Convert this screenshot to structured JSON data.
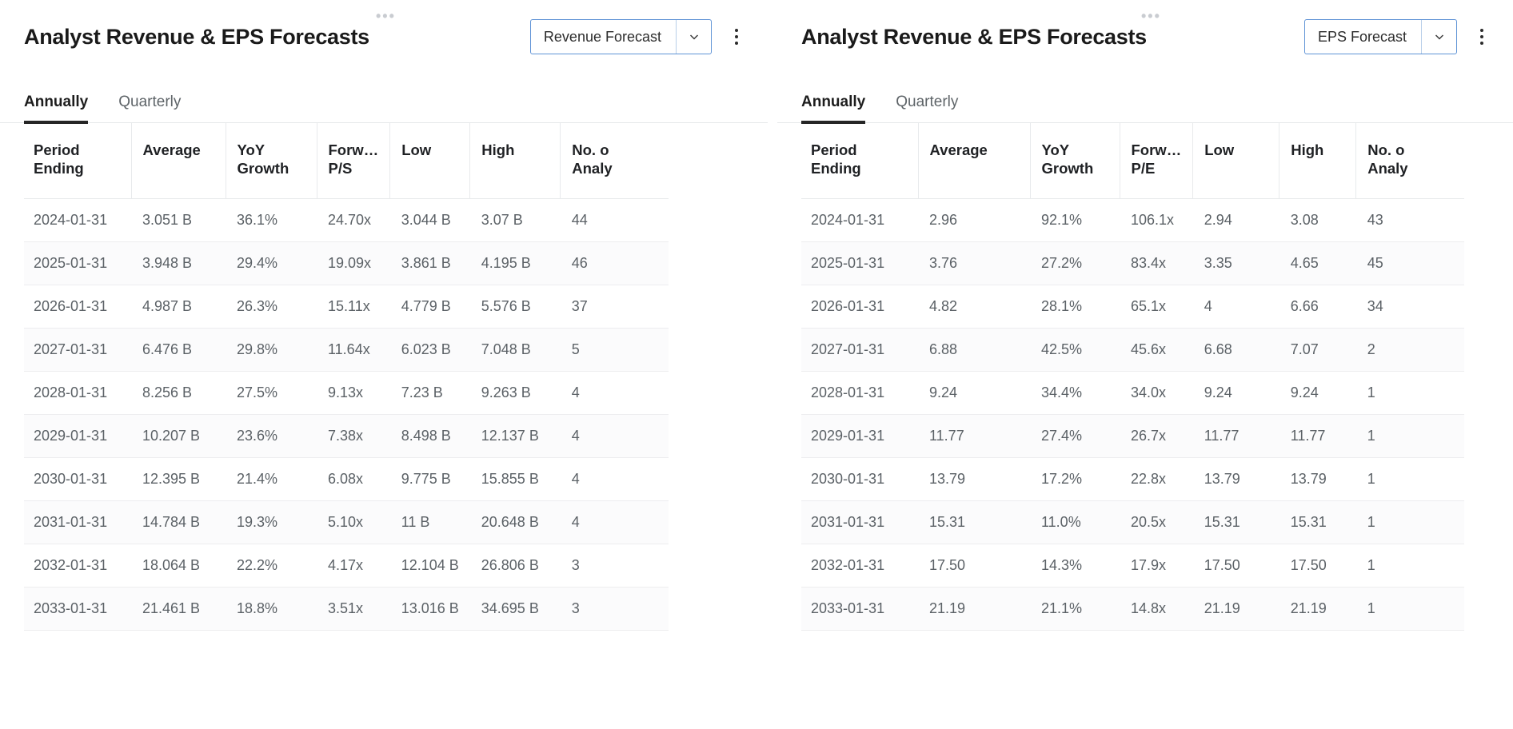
{
  "panels": [
    {
      "title": "Analyst Revenue & EPS Forecasts",
      "drag_handle": "•••",
      "selector": {
        "value": "Revenue Forecast",
        "arrow_icon": "chevron-down-icon"
      },
      "menu_icon": "kebab-menu-icon",
      "tabs": [
        {
          "label": "Annually",
          "active": true
        },
        {
          "label": "Quarterly",
          "active": false
        }
      ],
      "table": {
        "columns": [
          "Period Ending",
          "Average",
          "YoY Growth",
          "Forw… P/S",
          "Low",
          "High",
          "No. o Analy"
        ],
        "columns_line1": [
          "Period",
          "Average",
          "YoY",
          "Forw…",
          "Low",
          "High",
          "No. o"
        ],
        "columns_line2": [
          "Ending",
          "",
          "Growth",
          "P/S",
          "",
          "",
          "Analy"
        ],
        "rows": [
          [
            "2024-01-31",
            "3.051 B",
            "36.1%",
            "24.70x",
            "3.044 B",
            "3.07 B",
            "44"
          ],
          [
            "2025-01-31",
            "3.948 B",
            "29.4%",
            "19.09x",
            "3.861 B",
            "4.195 B",
            "46"
          ],
          [
            "2026-01-31",
            "4.987 B",
            "26.3%",
            "15.11x",
            "4.779 B",
            "5.576 B",
            "37"
          ],
          [
            "2027-01-31",
            "6.476 B",
            "29.8%",
            "11.64x",
            "6.023 B",
            "7.048 B",
            "5"
          ],
          [
            "2028-01-31",
            "8.256 B",
            "27.5%",
            "9.13x",
            "7.23 B",
            "9.263 B",
            "4"
          ],
          [
            "2029-01-31",
            "10.207 B",
            "23.6%",
            "7.38x",
            "8.498 B",
            "12.137 B",
            "4"
          ],
          [
            "2030-01-31",
            "12.395 B",
            "21.4%",
            "6.08x",
            "9.775 B",
            "15.855 B",
            "4"
          ],
          [
            "2031-01-31",
            "14.784 B",
            "19.3%",
            "5.10x",
            "11 B",
            "20.648 B",
            "4"
          ],
          [
            "2032-01-31",
            "18.064 B",
            "22.2%",
            "4.17x",
            "12.104 B",
            "26.806 B",
            "3"
          ],
          [
            "2033-01-31",
            "21.461 B",
            "18.8%",
            "3.51x",
            "13.016 B",
            "34.695 B",
            "3"
          ]
        ]
      }
    },
    {
      "title": "Analyst Revenue & EPS Forecasts",
      "drag_handle": "•••",
      "selector": {
        "value": "EPS Forecast",
        "arrow_icon": "chevron-down-icon"
      },
      "menu_icon": "kebab-menu-icon",
      "tabs": [
        {
          "label": "Annually",
          "active": true
        },
        {
          "label": "Quarterly",
          "active": false
        }
      ],
      "table": {
        "columns": [
          "Period Ending",
          "Average",
          "YoY Growth",
          "Forw… P/E",
          "Low",
          "High",
          "No. o Analy"
        ],
        "columns_line1": [
          "Period",
          "Average",
          "YoY",
          "Forw…",
          "Low",
          "High",
          "No. o"
        ],
        "columns_line2": [
          "Ending",
          "",
          "Growth",
          "P/E",
          "",
          "",
          "Analy"
        ],
        "rows": [
          [
            "2024-01-31",
            "2.96",
            "92.1%",
            "106.1x",
            "2.94",
            "3.08",
            "43"
          ],
          [
            "2025-01-31",
            "3.76",
            "27.2%",
            "83.4x",
            "3.35",
            "4.65",
            "45"
          ],
          [
            "2026-01-31",
            "4.82",
            "28.1%",
            "65.1x",
            "4",
            "6.66",
            "34"
          ],
          [
            "2027-01-31",
            "6.88",
            "42.5%",
            "45.6x",
            "6.68",
            "7.07",
            "2"
          ],
          [
            "2028-01-31",
            "9.24",
            "34.4%",
            "34.0x",
            "9.24",
            "9.24",
            "1"
          ],
          [
            "2029-01-31",
            "11.77",
            "27.4%",
            "26.7x",
            "11.77",
            "11.77",
            "1"
          ],
          [
            "2030-01-31",
            "13.79",
            "17.2%",
            "22.8x",
            "13.79",
            "13.79",
            "1"
          ],
          [
            "2031-01-31",
            "15.31",
            "11.0%",
            "20.5x",
            "15.31",
            "15.31",
            "1"
          ],
          [
            "2032-01-31",
            "17.50",
            "14.3%",
            "17.9x",
            "17.50",
            "17.50",
            "1"
          ],
          [
            "2033-01-31",
            "21.19",
            "21.1%",
            "14.8x",
            "21.19",
            "21.19",
            "1"
          ]
        ]
      }
    }
  ],
  "colors": {
    "accent_border": "#5f93d6",
    "tab_underline": "#262626",
    "text_primary": "#1f2124",
    "text_secondary": "#5b6166",
    "row_divider": "#ededef"
  }
}
